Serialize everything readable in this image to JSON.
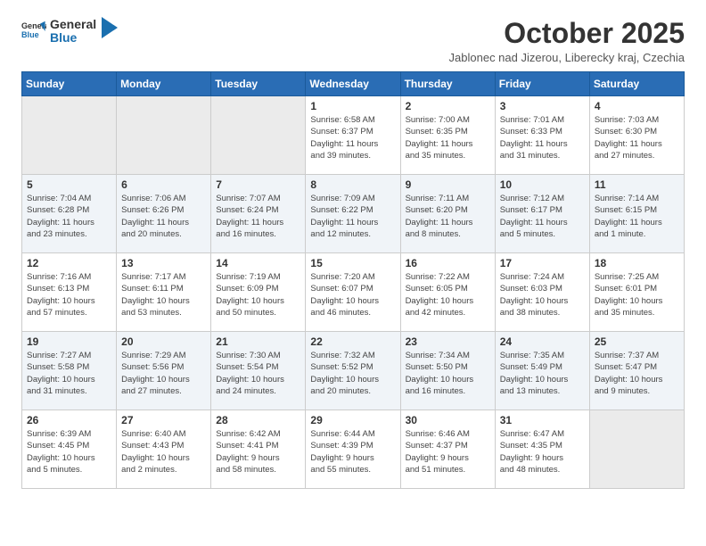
{
  "logo": {
    "general": "General",
    "blue": "Blue"
  },
  "title": "October 2025",
  "location": "Jablonec nad Jizerou, Liberecky kraj, Czechia",
  "header": {
    "colors": {
      "bg": "#2a6db5"
    }
  },
  "days_of_week": [
    "Sunday",
    "Monday",
    "Tuesday",
    "Wednesday",
    "Thursday",
    "Friday",
    "Saturday"
  ],
  "weeks": [
    {
      "days": [
        {
          "num": "",
          "info": ""
        },
        {
          "num": "",
          "info": ""
        },
        {
          "num": "",
          "info": ""
        },
        {
          "num": "1",
          "info": "Sunrise: 6:58 AM\nSunset: 6:37 PM\nDaylight: 11 hours\nand 39 minutes."
        },
        {
          "num": "2",
          "info": "Sunrise: 7:00 AM\nSunset: 6:35 PM\nDaylight: 11 hours\nand 35 minutes."
        },
        {
          "num": "3",
          "info": "Sunrise: 7:01 AM\nSunset: 6:33 PM\nDaylight: 11 hours\nand 31 minutes."
        },
        {
          "num": "4",
          "info": "Sunrise: 7:03 AM\nSunset: 6:30 PM\nDaylight: 11 hours\nand 27 minutes."
        }
      ]
    },
    {
      "days": [
        {
          "num": "5",
          "info": "Sunrise: 7:04 AM\nSunset: 6:28 PM\nDaylight: 11 hours\nand 23 minutes."
        },
        {
          "num": "6",
          "info": "Sunrise: 7:06 AM\nSunset: 6:26 PM\nDaylight: 11 hours\nand 20 minutes."
        },
        {
          "num": "7",
          "info": "Sunrise: 7:07 AM\nSunset: 6:24 PM\nDaylight: 11 hours\nand 16 minutes."
        },
        {
          "num": "8",
          "info": "Sunrise: 7:09 AM\nSunset: 6:22 PM\nDaylight: 11 hours\nand 12 minutes."
        },
        {
          "num": "9",
          "info": "Sunrise: 7:11 AM\nSunset: 6:20 PM\nDaylight: 11 hours\nand 8 minutes."
        },
        {
          "num": "10",
          "info": "Sunrise: 7:12 AM\nSunset: 6:17 PM\nDaylight: 11 hours\nand 5 minutes."
        },
        {
          "num": "11",
          "info": "Sunrise: 7:14 AM\nSunset: 6:15 PM\nDaylight: 11 hours\nand 1 minute."
        }
      ]
    },
    {
      "days": [
        {
          "num": "12",
          "info": "Sunrise: 7:16 AM\nSunset: 6:13 PM\nDaylight: 10 hours\nand 57 minutes."
        },
        {
          "num": "13",
          "info": "Sunrise: 7:17 AM\nSunset: 6:11 PM\nDaylight: 10 hours\nand 53 minutes."
        },
        {
          "num": "14",
          "info": "Sunrise: 7:19 AM\nSunset: 6:09 PM\nDaylight: 10 hours\nand 50 minutes."
        },
        {
          "num": "15",
          "info": "Sunrise: 7:20 AM\nSunset: 6:07 PM\nDaylight: 10 hours\nand 46 minutes."
        },
        {
          "num": "16",
          "info": "Sunrise: 7:22 AM\nSunset: 6:05 PM\nDaylight: 10 hours\nand 42 minutes."
        },
        {
          "num": "17",
          "info": "Sunrise: 7:24 AM\nSunset: 6:03 PM\nDaylight: 10 hours\nand 38 minutes."
        },
        {
          "num": "18",
          "info": "Sunrise: 7:25 AM\nSunset: 6:01 PM\nDaylight: 10 hours\nand 35 minutes."
        }
      ]
    },
    {
      "days": [
        {
          "num": "19",
          "info": "Sunrise: 7:27 AM\nSunset: 5:58 PM\nDaylight: 10 hours\nand 31 minutes."
        },
        {
          "num": "20",
          "info": "Sunrise: 7:29 AM\nSunset: 5:56 PM\nDaylight: 10 hours\nand 27 minutes."
        },
        {
          "num": "21",
          "info": "Sunrise: 7:30 AM\nSunset: 5:54 PM\nDaylight: 10 hours\nand 24 minutes."
        },
        {
          "num": "22",
          "info": "Sunrise: 7:32 AM\nSunset: 5:52 PM\nDaylight: 10 hours\nand 20 minutes."
        },
        {
          "num": "23",
          "info": "Sunrise: 7:34 AM\nSunset: 5:50 PM\nDaylight: 10 hours\nand 16 minutes."
        },
        {
          "num": "24",
          "info": "Sunrise: 7:35 AM\nSunset: 5:49 PM\nDaylight: 10 hours\nand 13 minutes."
        },
        {
          "num": "25",
          "info": "Sunrise: 7:37 AM\nSunset: 5:47 PM\nDaylight: 10 hours\nand 9 minutes."
        }
      ]
    },
    {
      "days": [
        {
          "num": "26",
          "info": "Sunrise: 6:39 AM\nSunset: 4:45 PM\nDaylight: 10 hours\nand 5 minutes."
        },
        {
          "num": "27",
          "info": "Sunrise: 6:40 AM\nSunset: 4:43 PM\nDaylight: 10 hours\nand 2 minutes."
        },
        {
          "num": "28",
          "info": "Sunrise: 6:42 AM\nSunset: 4:41 PM\nDaylight: 9 hours\nand 58 minutes."
        },
        {
          "num": "29",
          "info": "Sunrise: 6:44 AM\nSunset: 4:39 PM\nDaylight: 9 hours\nand 55 minutes."
        },
        {
          "num": "30",
          "info": "Sunrise: 6:46 AM\nSunset: 4:37 PM\nDaylight: 9 hours\nand 51 minutes."
        },
        {
          "num": "31",
          "info": "Sunrise: 6:47 AM\nSunset: 4:35 PM\nDaylight: 9 hours\nand 48 minutes."
        },
        {
          "num": "",
          "info": ""
        }
      ]
    }
  ]
}
